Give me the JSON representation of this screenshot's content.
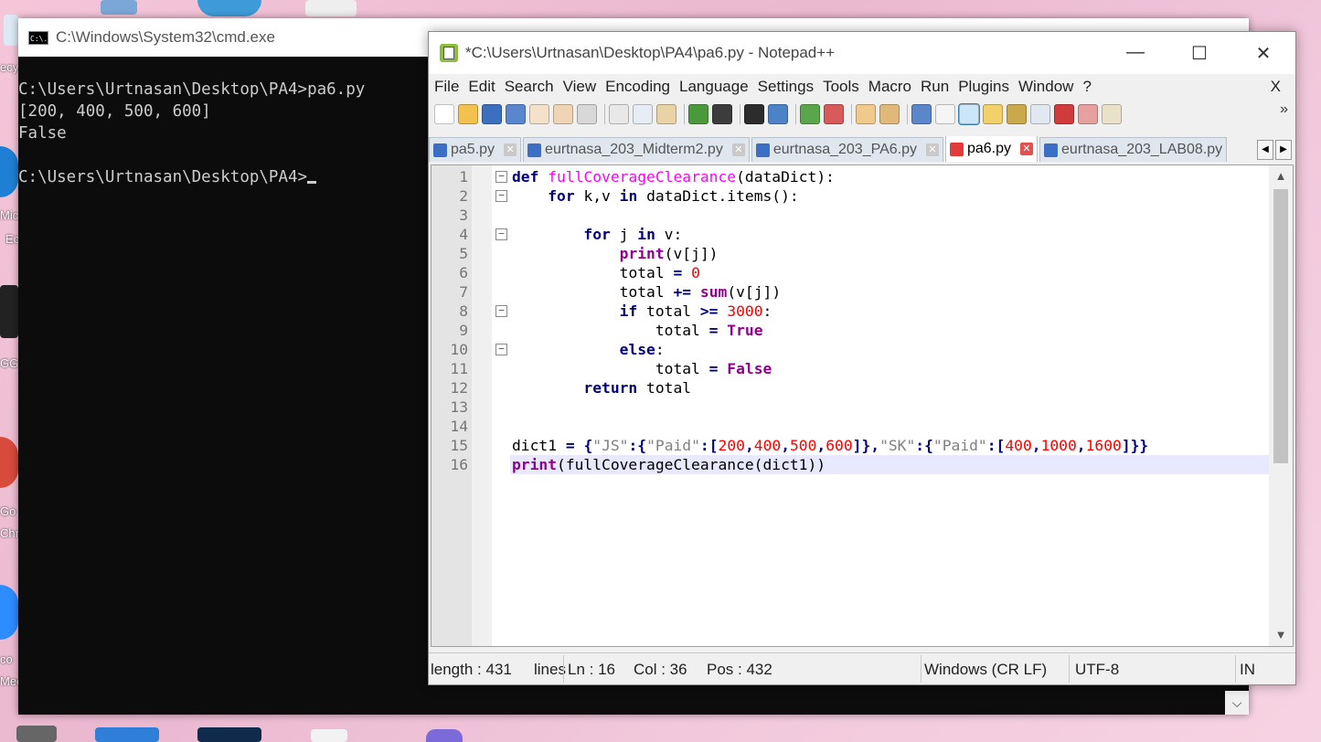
{
  "cmd": {
    "title": "C:\\Windows\\System32\\cmd.exe",
    "icon_text": "C:\\.",
    "lines": [
      "C:\\Users\\Urtnasan\\Desktop\\PA4>pa6.py",
      "[200, 400, 500, 600]",
      "False",
      "",
      "C:\\Users\\Urtnasan\\Desktop\\PA4>"
    ]
  },
  "npp": {
    "title": "*C:\\Users\\Urtnasan\\Desktop\\PA4\\pa6.py - Notepad++",
    "window_controls": {
      "minimize": "—",
      "maximize": "☐",
      "close": "✕"
    },
    "menu": [
      "File",
      "Edit",
      "Search",
      "View",
      "Encoding",
      "Language",
      "Settings",
      "Tools",
      "Macro",
      "Run",
      "Plugins",
      "Window",
      "?"
    ],
    "menu_close": "X",
    "toolbar_more": "»",
    "tabs": [
      {
        "label": "pa5.py",
        "active": false
      },
      {
        "label": "eurtnasa_203_Midterm2.py",
        "active": false
      },
      {
        "label": "eurtnasa_203_PA6.py",
        "active": false
      },
      {
        "label": "pa6.py",
        "active": true
      },
      {
        "label": "eurtnasa_203_LAB08.py",
        "active": false
      }
    ],
    "line_numbers": [
      "1",
      "2",
      "3",
      "4",
      "5",
      "6",
      "7",
      "8",
      "9",
      "10",
      "11",
      "12",
      "13",
      "14",
      "15",
      "16"
    ],
    "status": {
      "length": "length : 431",
      "lines": "lines",
      "ln": "Ln : 16",
      "col": "Col : 36",
      "pos": "Pos : 432",
      "eol": "Windows (CR LF)",
      "encoding": "UTF-8",
      "mode": "IN"
    }
  },
  "code": {
    "l1_kw": "def",
    "l1_fn": "fullCoverageClearance",
    "l1_rest": "(dataDict):",
    "l2_kw1": "for",
    "l2_a": " k,v ",
    "l2_kw2": "in",
    "l2_b": " dataDict.items():",
    "l4_kw1": "for",
    "l4_a": " j ",
    "l4_kw2": "in",
    "l4_b": " v:",
    "l5_bi": "print",
    "l5_rest": "(v[j])",
    "l6_a": "total ",
    "l6_op": "=",
    "l6_num": "0",
    "l7_a": "total ",
    "l7_op": "+=",
    "l7_bi": "sum",
    "l7_rest": "(v[j])",
    "l8_kw": "if",
    "l8_a": " total ",
    "l8_op": ">=",
    "l8_num": "3000",
    "l8_b": ":",
    "l9_a": "total ",
    "l9_op": "=",
    "l9_bi": "True",
    "l10_kw": "else",
    "l10_b": ":",
    "l11_a": "total ",
    "l11_op": "=",
    "l11_bi": "False",
    "l12_kw": "return",
    "l12_a": " total",
    "l15_a": "dict1 ",
    "l15_op": "=",
    "l15_b": "{",
    "l15_s1": "\"JS\"",
    "l15_c": ":{",
    "l15_s2": "\"Paid\"",
    "l15_d": ":[",
    "l15_n1": "200",
    "l15_n2": "400",
    "l15_n3": "500",
    "l15_n4": "600",
    "l15_e": "]},",
    "l15_s3": "\"SK\"",
    "l15_s4": "\"Paid\"",
    "l15_n5": "400",
    "l15_n6": "1000",
    "l15_n7": "1600",
    "l15_f": "]}}",
    "l16_bi": "print",
    "l16_a": "(fullCoverageClearance(dict1))",
    "comma": ","
  },
  "desktop_labels": [
    "ecy",
    "Mic",
    "Ec",
    "GG",
    "Go",
    "Chr",
    "co",
    "Mee"
  ]
}
